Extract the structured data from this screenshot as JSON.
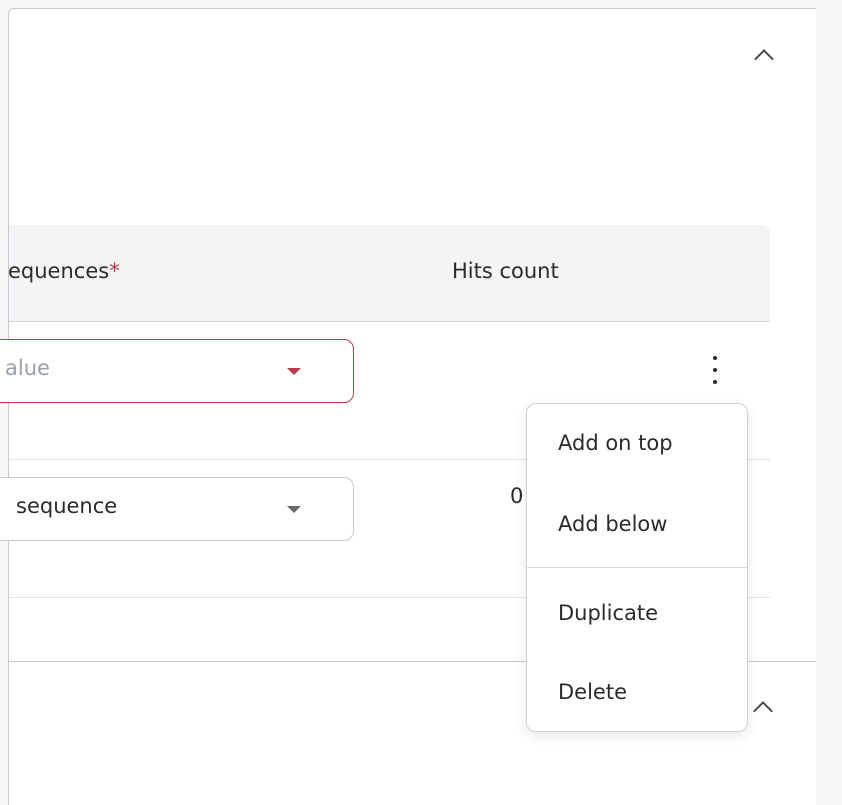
{
  "table": {
    "headers": {
      "sequences": "equences",
      "required_mark": "*",
      "hits_count": "Hits count"
    },
    "rows": [
      {
        "select_value": "alue",
        "hits_count": ""
      },
      {
        "select_value": "sequence",
        "hits_count": "0"
      }
    ]
  },
  "row_menu": {
    "items": [
      {
        "label": "Add on top"
      },
      {
        "label": "Add below"
      },
      {
        "label": "Duplicate"
      },
      {
        "label": "Delete"
      }
    ]
  },
  "icons": {
    "collapse": "chevron-up-icon",
    "row_actions": "more-vertical-icon",
    "dropdown": "caret-down-icon"
  },
  "colors": {
    "accent_error": "#b83a4b",
    "neutral_caret": "#6b6b6b",
    "border": "#c9c9cf",
    "header_bg": "#f4f4f6"
  }
}
